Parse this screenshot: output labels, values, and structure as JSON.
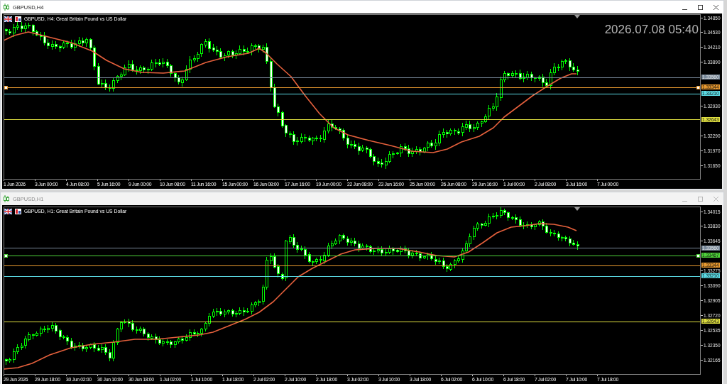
{
  "windows": [
    {
      "title": "GBPUSD,H4",
      "active": true,
      "chart": {
        "header": "GBPUSD, H4: Great Britain Pound vs US Dollar",
        "clock": "2026.07.08 05:40",
        "price_ticks": [
          "1.34850",
          "1.34530",
          "1.34210",
          "1.33890",
          "1.32930",
          "1.32290",
          "1.31970",
          "1.31650"
        ],
        "price_lines": [
          {
            "label": "1.33560",
            "color": "#778899",
            "selected": false
          },
          {
            "label": "1.33344",
            "color": "#e89a30",
            "selected": true
          },
          {
            "label": "1.33210",
            "color": "#5cdce6",
            "selected": false
          },
          {
            "label": "1.32643",
            "color": "#e0e040",
            "selected": false
          }
        ],
        "time_ticks": [
          "1 Jun 2026",
          "3 Jun 00:00",
          "4 Jun 08:00",
          "5 Jun 16:00",
          "9 Jun 00:00",
          "10 Jun 08:00",
          "11 Jun 16:00",
          "15 Jun 00:00",
          "16 Jun 08:00",
          "17 Jun 16:00",
          "19 Jun 00:00",
          "22 Jun 08:00",
          "23 Jun 16:00",
          "25 Jun 00:00",
          "26 Jun 08:00",
          "29 Jun 16:00",
          "1 Jul 00:00",
          "2 Jul 08:00",
          "3 Jul 16:00",
          "7 Jul 00:00"
        ]
      }
    },
    {
      "title": "GBPUSD,H1",
      "active": false,
      "chart": {
        "header": "GBPUSD, H1: Great Britain Pound vs US Dollar",
        "price_ticks": [
          "1.34015",
          "1.33830",
          "1.33645",
          "1.33275",
          "1.33090",
          "1.32905",
          "1.32720",
          "1.32535",
          "1.32350",
          "1.32165"
        ],
        "price_lines": [
          {
            "label": "1.33560",
            "color": "#778899",
            "selected": false
          },
          {
            "label": "1.33467",
            "color": "#4ed33a",
            "selected": true
          },
          {
            "label": "1.33344",
            "color": "#e89a30",
            "selected": false
          },
          {
            "label": "1.33210",
            "color": "#5cdce6",
            "selected": false
          },
          {
            "label": "1.32643",
            "color": "#e0e040",
            "selected": false
          }
        ],
        "time_ticks": [
          "29 Jun 2026",
          "29 Jun 18:00",
          "30 Jun 02:00",
          "30 Jun 10:00",
          "30 Jun 18:00",
          "1 Jul 02:00",
          "1 Jul 10:00",
          "1 Jul 18:00",
          "2 Jul 02:00",
          "2 Jul 10:00",
          "2 Jul 18:00",
          "3 Jul 02:00",
          "3 Jul 10:00",
          "3 Jul 18:00",
          "6 Jul 02:00",
          "6 Jul 10:00",
          "6 Jul 18:00",
          "7 Jul 02:00",
          "7 Jul 10:00",
          "7 Jul 18:00"
        ]
      }
    }
  ]
}
